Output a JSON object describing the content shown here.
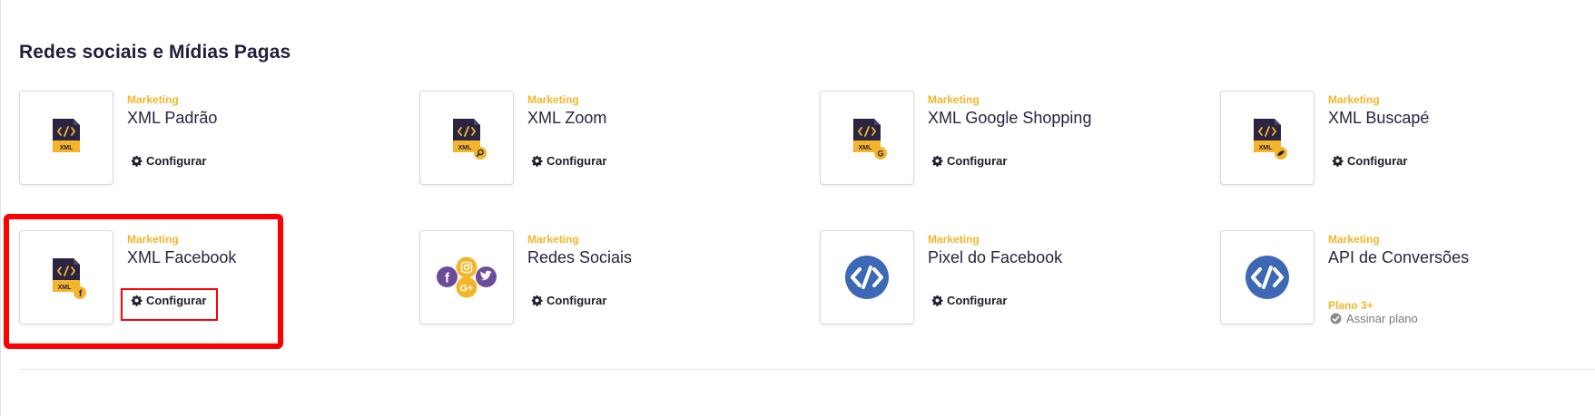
{
  "section": {
    "title": "Redes sociais e Mídias Pagas"
  },
  "cards": [
    {
      "tag": "Marketing",
      "name": "XML Padrão",
      "action": "Configurar",
      "icon": "xml-file-icon",
      "badge": "XML"
    },
    {
      "tag": "Marketing",
      "name": "XML Zoom",
      "action": "Configurar",
      "icon": "xml-zoom-icon",
      "badge": "XML"
    },
    {
      "tag": "Marketing",
      "name": "XML Google Shopping",
      "action": "Configurar",
      "icon": "xml-google-icon",
      "badge": "XML"
    },
    {
      "tag": "Marketing",
      "name": "XML Buscapé",
      "action": "Configurar",
      "icon": "xml-buscape-icon",
      "badge": "XML"
    },
    {
      "tag": "Marketing",
      "name": "XML Facebook",
      "action": "Configurar",
      "icon": "xml-facebook-icon",
      "badge": "XML"
    },
    {
      "tag": "Marketing",
      "name": "Redes Sociais",
      "action": "Configurar",
      "icon": "social-networks-icon"
    },
    {
      "tag": "Marketing",
      "name": "Pixel do Facebook",
      "action": "Configurar",
      "icon": "code-circle-icon"
    },
    {
      "tag": "Marketing",
      "name": "API de Conversões",
      "plan": "Plano 3+",
      "action": "Assinar plano",
      "icon": "code-circle-icon"
    }
  ],
  "colors": {
    "accent": "#f5b52a",
    "dark": "#2a2440",
    "code_blue": "#3d68b6",
    "highlight": "#ff0000",
    "social_purple": "#6b4c9a"
  }
}
